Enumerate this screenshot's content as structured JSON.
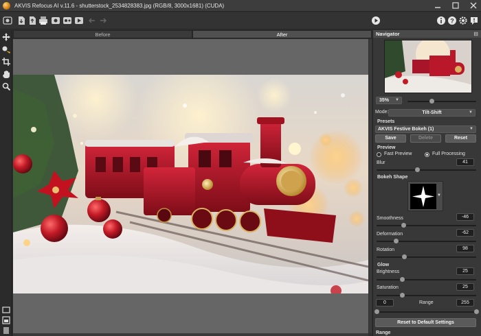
{
  "window": {
    "title": "AKVIS Refocus AI v.11.6 - shutterstock_2534828383.jpg (RGB/8, 3000x1681) (CUDA)"
  },
  "toolbar": {
    "icons": [
      "open-image-icon",
      "save-image-icon",
      "export-icon",
      "print-icon",
      "before-after-icon",
      "batch-icon",
      "plugin-icon",
      "undo-icon",
      "redo-icon",
      "run-icon",
      "info-icon",
      "help-icon",
      "settings-icon",
      "notifications-icon"
    ]
  },
  "tools": {
    "items": [
      "move-tool-icon",
      "focus-brush-icon",
      "crop-icon",
      "hand-tool-icon",
      "zoom-tool-icon"
    ],
    "bottom": [
      "show-canvas-icon",
      "split-view-icon",
      "panel-toggle-icon"
    ]
  },
  "view_tabs": {
    "before": "Before",
    "after": "After"
  },
  "navigator": {
    "header": "Navigator",
    "zoom": "35%"
  },
  "settings": {
    "mode_label": "Mode:",
    "mode_value": "Tilt-Shift",
    "presets_header": "Presets",
    "preset_value": "AKVIS Festive Bokeh (1)",
    "save": "Save",
    "delete": "Delete",
    "reset": "Reset",
    "preview_header": "Preview",
    "fast_preview": "Fast Preview",
    "full_processing": "Full Processing",
    "blur_label": "Blur",
    "blur_value": "41",
    "bokeh_header": "Bokeh Shape",
    "smoothness_label": "Smoothness",
    "smoothness_value": "-46",
    "deformation_label": "Deformation",
    "deformation_value": "-62",
    "rotation_label": "Rotation",
    "rotation_value": "98",
    "glow_header": "Glow",
    "brightness_label": "Brightness",
    "brightness_value": "25",
    "saturation_label": "Saturation",
    "saturation_value": "25",
    "range_label": "Range",
    "range_min": "0",
    "range_max": "255",
    "reset_defaults": "Reset to Default Settings",
    "range_header": "Range"
  },
  "colors": {
    "panel_bg": "#383838",
    "header_bg": "#4a4a4a",
    "canvas_bg": "#666666",
    "train_red": "#b8182a"
  }
}
